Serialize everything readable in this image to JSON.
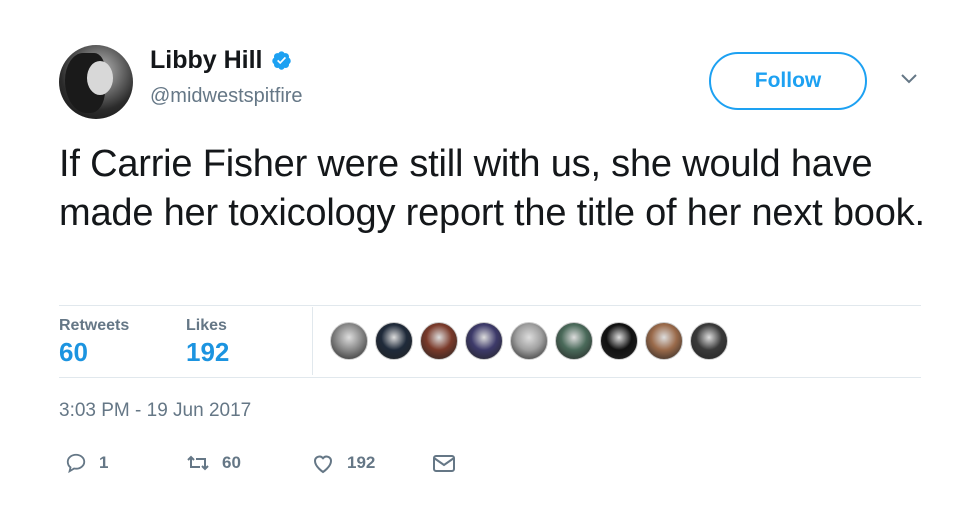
{
  "user": {
    "name": "Libby Hill",
    "handle": "@midwestspitfire",
    "verified_icon": "verified-badge-icon"
  },
  "header": {
    "follow_label": "Follow",
    "menu_icon": "chevron-down-icon"
  },
  "tweet": {
    "text": "If Carrie Fisher were still with us, she would have made her toxicology report the title of her next book."
  },
  "stats": {
    "retweets_label": "Retweets",
    "retweets_value": "60",
    "likes_label": "Likes",
    "likes_value": "192"
  },
  "likers": [
    {
      "name": "liker-avatar-1",
      "color": "#8a8a8a"
    },
    {
      "name": "liker-avatar-2",
      "color": "#1f2a3a"
    },
    {
      "name": "liker-avatar-3",
      "color": "#7a3a2a"
    },
    {
      "name": "liker-avatar-4",
      "color": "#3d3a6a"
    },
    {
      "name": "liker-avatar-5",
      "color": "#a0a0a0"
    },
    {
      "name": "liker-avatar-6",
      "color": "#4a6a5a"
    },
    {
      "name": "liker-avatar-7",
      "color": "#111111"
    },
    {
      "name": "liker-avatar-8",
      "color": "#9a6a4a"
    },
    {
      "name": "liker-avatar-9",
      "color": "#3a3a3a"
    }
  ],
  "timestamp": "3:03 PM - 19 Jun 2017",
  "actions": {
    "reply_count": "1",
    "retweet_count": "60",
    "like_count": "192"
  },
  "colors": {
    "accent": "#1da1f2",
    "count_blue": "#1c94e0",
    "secondary_text": "#657786",
    "divider": "#e1e8ed"
  }
}
